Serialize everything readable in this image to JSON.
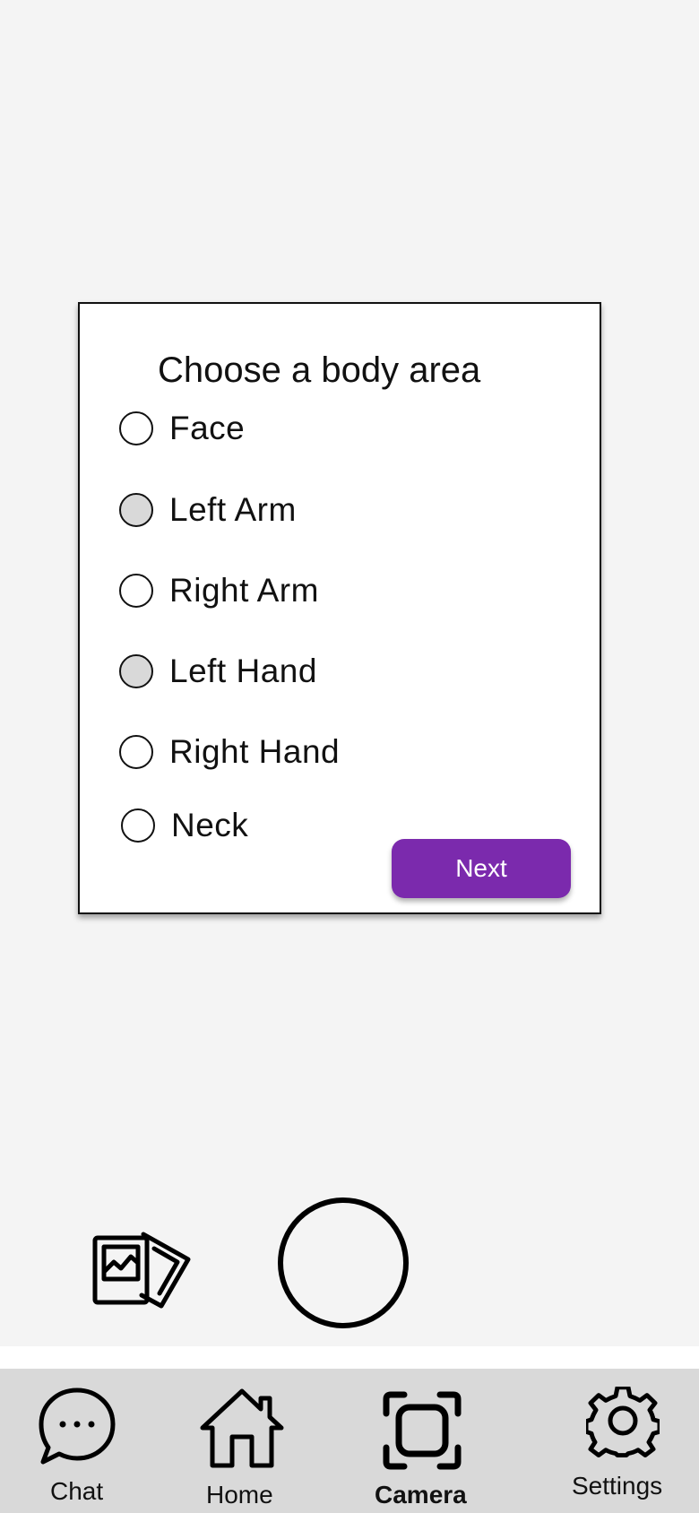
{
  "dialog": {
    "title": "Choose a body area",
    "options": [
      {
        "label": "Face",
        "filled": false
      },
      {
        "label": "Left Arm",
        "filled": true
      },
      {
        "label": "Right Arm",
        "filled": false
      },
      {
        "label": "Left Hand",
        "filled": true
      },
      {
        "label": "Right Hand",
        "filled": false
      },
      {
        "label": "Neck",
        "filled": false
      }
    ],
    "next_label": "Next"
  },
  "camera": {
    "gallery_icon": "gallery-icon",
    "shutter_icon": "shutter-button"
  },
  "nav": {
    "items": [
      {
        "label": "Chat",
        "icon": "chat-icon",
        "active": false
      },
      {
        "label": "Home",
        "icon": "home-icon",
        "active": false
      },
      {
        "label": "Camera",
        "icon": "camera-scan-icon",
        "active": true
      },
      {
        "label": "Settings",
        "icon": "gear-icon",
        "active": false
      }
    ]
  },
  "colors": {
    "accent": "#7b2aad",
    "background": "#f4f4f4",
    "nav_background": "#d9d9d9",
    "radio_fill": "#d9d9d9"
  }
}
